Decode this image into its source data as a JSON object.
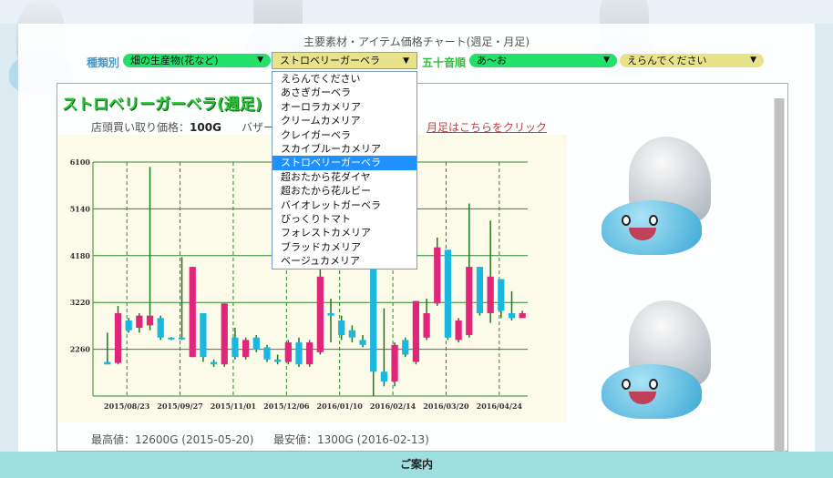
{
  "page": {
    "title": "主要素材・アイテム価格チャート(週足・月足)"
  },
  "filters": {
    "category_label": "種類別",
    "category_value": "畑の生産物(花など)",
    "item_value": "ストロベリーガーベラ",
    "syllabary_label": "五十音順",
    "syllabary_value": "あ〜お",
    "syllabary_item_value": "えらんでください"
  },
  "dropdown": {
    "items": [
      "えらんでください",
      "あさぎガーベラ",
      "オーロラカメリア",
      "クリームカメリア",
      "クレイガーベラ",
      "スカイブルーカメリア",
      "ストロベリーガーベラ",
      "超おたから花ダイヤ",
      "超おたから花ルビー",
      "バイオレットガーベラ",
      "びっくりトマト",
      "フォレストカメリア",
      "ブラッドカメリア",
      "ベージュカメリア"
    ],
    "selected_index": 6
  },
  "item": {
    "title": "ストロベリーガーベラ(週足)",
    "shop_price_label": "店頭買い取り価格：",
    "shop_price": "100G",
    "bazaar_label": "バザー",
    "monthly_link": "月足はこちらをクリック"
  },
  "stats": {
    "max_label": "最高値：",
    "max_value": "12600G (2015-05-20)",
    "min_label": "最安値：",
    "min_value": "1300G (2016-02-13)"
  },
  "footer": {
    "label": "ご案内"
  },
  "colors": {
    "up": "#e0257a",
    "down": "#1ab8e0",
    "wick": "#1e7a1e",
    "grid": "#2a8a2a",
    "title": "#2ec43a"
  },
  "chart_data": {
    "type": "candlestick",
    "title": "",
    "xlabel": "",
    "ylabel": "",
    "ylim": [
      1300,
      6100
    ],
    "yticks": [
      6100,
      5140,
      4180,
      3220,
      2260
    ],
    "x_labels": [
      "2015/08/23",
      "2015/09/27",
      "2015/11/01",
      "2015/12/06",
      "2016/01/10",
      "2016/02/14",
      "2016/03/20",
      "2016/04/24"
    ],
    "grid": true,
    "candles": [
      {
        "o": 2000,
        "c": 1950,
        "h": 2600,
        "l": 1950
      },
      {
        "o": 1980,
        "c": 3000,
        "h": 3150,
        "l": 1950
      },
      {
        "o": 2850,
        "c": 2650,
        "h": 2900,
        "l": 2600
      },
      {
        "o": 2700,
        "c": 2950,
        "h": 3000,
        "l": 2600
      },
      {
        "o": 2750,
        "c": 2950,
        "h": 6000,
        "l": 2650
      },
      {
        "o": 2900,
        "c": 2500,
        "h": 2950,
        "l": 2450
      },
      {
        "o": 2500,
        "c": 2480,
        "h": 2510,
        "l": 2450
      },
      {
        "o": 2500,
        "c": 2480,
        "h": 4150,
        "l": 2450
      },
      {
        "o": 2100,
        "c": 3950,
        "h": 3950,
        "l": 2100
      },
      {
        "o": 3000,
        "c": 2100,
        "h": 3000,
        "l": 2000
      },
      {
        "o": 2000,
        "c": 1950,
        "h": 2050,
        "l": 1900
      },
      {
        "o": 1950,
        "c": 3200,
        "h": 3200,
        "l": 1900
      },
      {
        "o": 2500,
        "c": 2100,
        "h": 2700,
        "l": 2050
      },
      {
        "o": 2100,
        "c": 2450,
        "h": 2500,
        "l": 2050
      },
      {
        "o": 2500,
        "c": 2250,
        "h": 2550,
        "l": 2200
      },
      {
        "o": 2300,
        "c": 2050,
        "h": 2350,
        "l": 2000
      },
      {
        "o": 2050,
        "c": 2000,
        "h": 2150,
        "l": 1950
      },
      {
        "o": 2000,
        "c": 2400,
        "h": 2450,
        "l": 1950
      },
      {
        "o": 2400,
        "c": 1950,
        "h": 2500,
        "l": 1900
      },
      {
        "o": 1950,
        "c": 2400,
        "h": 2450,
        "l": 1900
      },
      {
        "o": 2200,
        "c": 3750,
        "h": 3900,
        "l": 2150
      },
      {
        "o": 3000,
        "c": 2950,
        "h": 3300,
        "l": 2400
      },
      {
        "o": 2850,
        "c": 2550,
        "h": 2950,
        "l": 2450
      },
      {
        "o": 2650,
        "c": 2500,
        "h": 2750,
        "l": 2400
      },
      {
        "o": 2450,
        "c": 2350,
        "h": 2550,
        "l": 2300
      },
      {
        "o": 3950,
        "c": 1800,
        "h": 3950,
        "l": 1300
      },
      {
        "o": 1800,
        "c": 1600,
        "h": 3100,
        "l": 1500
      },
      {
        "o": 1600,
        "c": 2350,
        "h": 2400,
        "l": 1500
      },
      {
        "o": 2450,
        "c": 2150,
        "h": 2500,
        "l": 2100
      },
      {
        "o": 2000,
        "c": 3250,
        "h": 3250,
        "l": 1950
      },
      {
        "o": 2500,
        "c": 3000,
        "h": 3300,
        "l": 2450
      },
      {
        "o": 3200,
        "c": 4350,
        "h": 4550,
        "l": 3150
      },
      {
        "o": 4300,
        "c": 2500,
        "h": 4300,
        "l": 2450
      },
      {
        "o": 2450,
        "c": 2850,
        "h": 2900,
        "l": 2400
      },
      {
        "o": 2550,
        "c": 3950,
        "h": 5250,
        "l": 2500
      },
      {
        "o": 3950,
        "c": 3000,
        "h": 3950,
        "l": 2950
      },
      {
        "o": 3000,
        "c": 3750,
        "h": 4900,
        "l": 2800
      },
      {
        "o": 3700,
        "c": 3050,
        "h": 3700,
        "l": 2900
      },
      {
        "o": 3000,
        "c": 2900,
        "h": 3450,
        "l": 2850
      },
      {
        "o": 2900,
        "c": 3000,
        "h": 3050,
        "l": 2900
      }
    ]
  }
}
